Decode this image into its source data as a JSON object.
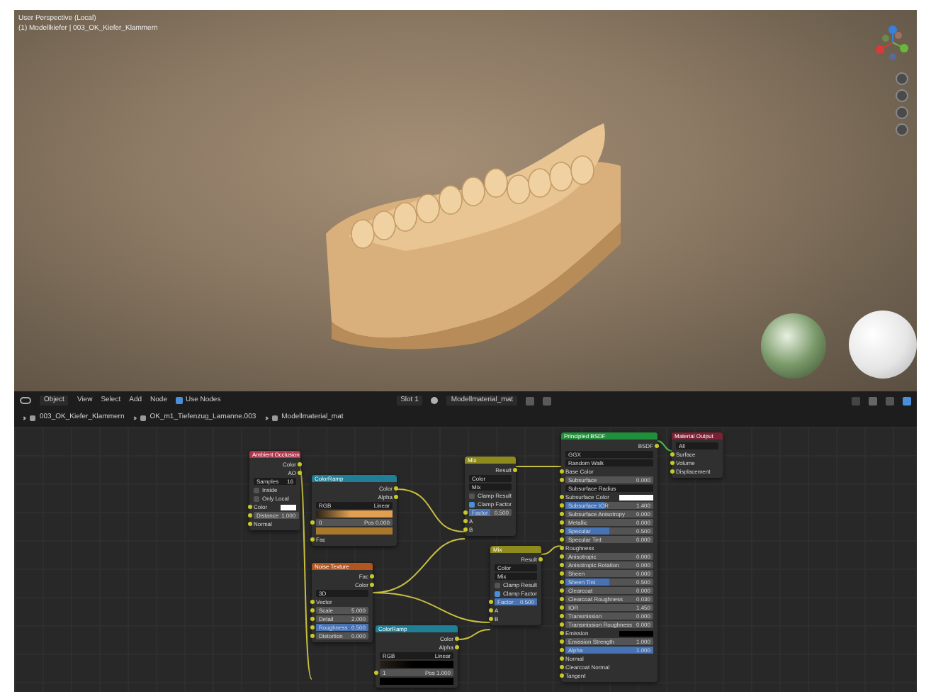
{
  "viewport": {
    "title": "User Perspective (Local)",
    "subtitle": "(1) Modellkiefer | 003_OK_Kiefer_Klammern"
  },
  "header": {
    "mode": "Object",
    "menus": [
      "View",
      "Select",
      "Add",
      "Node"
    ],
    "use_nodes": {
      "label": "Use Nodes",
      "checked": true
    },
    "slot": "Slot 1",
    "material": "Modellmaterial_mat"
  },
  "breadcrumb": [
    "003_OK_Kiefer_Klammern",
    "OK_m1_Tiefenzug_Lamanne.003",
    "Modellmaterial_mat"
  ],
  "nodes": [
    {
      "title": "Ambient Occlusion",
      "color": "#b3334a",
      "rows": [
        {
          "kind": "out",
          "label": "Color"
        },
        {
          "kind": "out",
          "label": "AO"
        },
        {
          "kind": "dropdown",
          "label": "Samples",
          "value": "16"
        },
        {
          "kind": "check",
          "label": "Inside",
          "checked": false
        },
        {
          "kind": "check",
          "label": "Only Local",
          "checked": false
        },
        {
          "kind": "color",
          "label": "Color",
          "color": "#ffffff"
        },
        {
          "kind": "value",
          "label": "Distance",
          "value": "1.000"
        },
        {
          "kind": "in",
          "label": "Normal"
        }
      ]
    },
    {
      "title": "ColorRamp",
      "color": "#1e7f96",
      "rows": [
        {
          "kind": "out",
          "label": "Color"
        },
        {
          "kind": "out",
          "label": "Alpha"
        },
        {
          "kind": "dropdown",
          "label": "RGB",
          "value": "Linear"
        },
        {
          "kind": "ramp",
          "color": "#e0a050"
        },
        {
          "kind": "value",
          "label": "0",
          "value": "Pos 0.000"
        },
        {
          "kind": "bar",
          "color": "#a9782f"
        },
        {
          "kind": "in",
          "label": "Fac"
        }
      ]
    },
    {
      "title": "Mix",
      "color": "#8e8a1e",
      "rows": [
        {
          "kind": "out",
          "label": "Result"
        },
        {
          "kind": "dropdown",
          "label": "Color",
          "value": ""
        },
        {
          "kind": "dropdown",
          "label": "Mix",
          "value": ""
        },
        {
          "kind": "check",
          "label": "Clamp Result",
          "checked": false
        },
        {
          "kind": "check",
          "label": "Clamp Factor",
          "checked": true
        },
        {
          "kind": "value",
          "label": "Factor",
          "value": "0.500",
          "level": 0.5
        },
        {
          "kind": "in",
          "label": "A"
        },
        {
          "kind": "in",
          "label": "B"
        }
      ]
    },
    {
      "title": "Noise Texture",
      "color": "#b4541e",
      "rows": [
        {
          "kind": "out",
          "label": "Fac"
        },
        {
          "kind": "out",
          "label": "Color"
        },
        {
          "kind": "dropdown",
          "label": "3D",
          "value": ""
        },
        {
          "kind": "in",
          "label": "Vector"
        },
        {
          "kind": "value",
          "label": "Scale",
          "value": "5.000"
        },
        {
          "kind": "value",
          "label": "Detail",
          "value": "2.000"
        },
        {
          "kind": "value",
          "label": "Roughness",
          "value": "0.500",
          "level": 1
        },
        {
          "kind": "value",
          "label": "Distortion",
          "value": "0.000"
        }
      ]
    },
    {
      "title": "Mix",
      "color": "#8e8a1e",
      "rows": [
        {
          "kind": "out",
          "label": "Result"
        },
        {
          "kind": "dropdown",
          "label": "Color",
          "value": ""
        },
        {
          "kind": "dropdown",
          "label": "Mix",
          "value": ""
        },
        {
          "kind": "check",
          "label": "Clamp Result",
          "checked": false
        },
        {
          "kind": "check",
          "label": "Clamp Factor",
          "checked": true
        },
        {
          "kind": "value",
          "label": "Factor",
          "value": "0.500",
          "level": 1
        },
        {
          "kind": "in",
          "label": "A"
        },
        {
          "kind": "in",
          "label": "B"
        }
      ]
    },
    {
      "title": "ColorRamp",
      "color": "#1e7f96",
      "rows": [
        {
          "kind": "out",
          "label": "Color"
        },
        {
          "kind": "out",
          "label": "Alpha"
        },
        {
          "kind": "dropdown",
          "label": "RGB",
          "value": "Linear"
        },
        {
          "kind": "ramp",
          "color": "#000000"
        },
        {
          "kind": "value",
          "label": "1",
          "value": "Pos 1.000"
        },
        {
          "kind": "bar",
          "color": "#000000"
        }
      ]
    },
    {
      "title": "Principled BSDF",
      "color": "#1f8f3a",
      "rows": [
        {
          "kind": "out",
          "label": "BSDF"
        },
        {
          "kind": "dropdown",
          "label": "GGX",
          "value": ""
        },
        {
          "kind": "dropdown",
          "label": "Random Walk",
          "value": ""
        },
        {
          "kind": "in",
          "label": "Base Color"
        },
        {
          "kind": "value",
          "label": "Subsurface",
          "value": "0.000"
        },
        {
          "kind": "dropdown",
          "label": "Subsurface Radius",
          "value": ""
        },
        {
          "kind": "color",
          "label": "Subsurface Color",
          "color": "#ffffff"
        },
        {
          "kind": "value",
          "label": "Subsurface IOR",
          "value": "1.400",
          "level": 0.45
        },
        {
          "kind": "value",
          "label": "Subsurface Anisotropy",
          "value": "0.000"
        },
        {
          "kind": "value",
          "label": "Metallic",
          "value": "0.000"
        },
        {
          "kind": "value",
          "label": "Specular",
          "value": "0.500",
          "level": 0.5
        },
        {
          "kind": "value",
          "label": "Specular Tint",
          "value": "0.000"
        },
        {
          "kind": "in",
          "label": "Roughness"
        },
        {
          "kind": "value",
          "label": "Anisotropic",
          "value": "0.000"
        },
        {
          "kind": "value",
          "label": "Anisotropic Rotation",
          "value": "0.000"
        },
        {
          "kind": "value",
          "label": "Sheen",
          "value": "0.000"
        },
        {
          "kind": "value",
          "label": "Sheen Tint",
          "value": "0.500",
          "level": 0.5
        },
        {
          "kind": "value",
          "label": "Clearcoat",
          "value": "0.000"
        },
        {
          "kind": "value",
          "label": "Clearcoat Roughness",
          "value": "0.030"
        },
        {
          "kind": "value",
          "label": "IOR",
          "value": "1.450"
        },
        {
          "kind": "value",
          "label": "Transmission",
          "value": "0.000"
        },
        {
          "kind": "value",
          "label": "Transmission Roughness",
          "value": "0.000"
        },
        {
          "kind": "color",
          "label": "Emission",
          "color": "#000000"
        },
        {
          "kind": "value",
          "label": "Emission Strength",
          "value": "1.000"
        },
        {
          "kind": "value",
          "label": "Alpha",
          "value": "1.000",
          "level": 1
        },
        {
          "kind": "in",
          "label": "Normal"
        },
        {
          "kind": "in",
          "label": "Clearcoat Normal"
        },
        {
          "kind": "in",
          "label": "Tangent"
        }
      ]
    },
    {
      "title": "Material Output",
      "color": "#7a2233",
      "rows": [
        {
          "kind": "dropdown",
          "label": "All",
          "value": ""
        },
        {
          "kind": "in",
          "label": "Surface"
        },
        {
          "kind": "in",
          "label": "Volume"
        },
        {
          "kind": "in",
          "label": "Displacement"
        }
      ]
    }
  ]
}
